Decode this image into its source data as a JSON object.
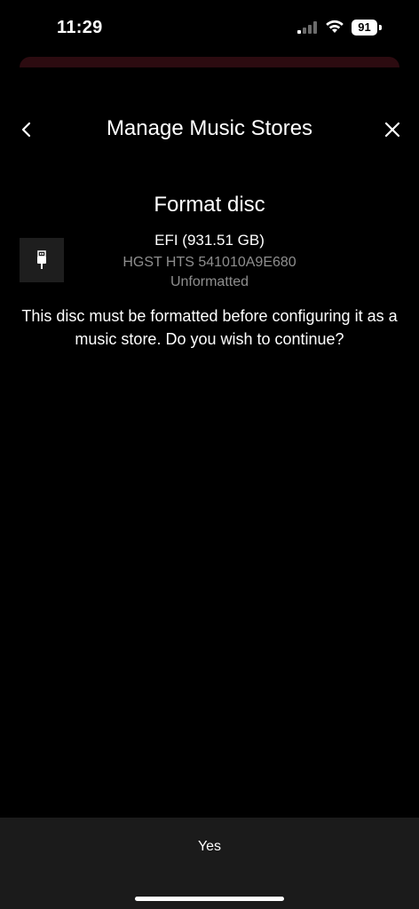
{
  "status_bar": {
    "time": "11:29",
    "battery_level": "91",
    "signal_icon": "cellular-signal-icon",
    "wifi_icon": "wifi-icon"
  },
  "header": {
    "title": "Manage Music Stores",
    "back_icon": "chevron-left-icon",
    "close_icon": "close-icon"
  },
  "dialog": {
    "title": "Format disc",
    "disc": {
      "icon": "usb-drive-icon",
      "name": "EFI (931.51 GB)",
      "model": "HGST HTS 541010A9E680",
      "status": "Unformatted"
    },
    "message": "This disc must be formatted before configuring it as a music store. Do you wish to continue?"
  },
  "actions": {
    "confirm_label": "Yes"
  },
  "colors": {
    "background": "#000000",
    "bottom_bar": "#1b1b1b",
    "secondary_text": "#8e8e8e",
    "sheet_edge": "#2c0b10"
  }
}
